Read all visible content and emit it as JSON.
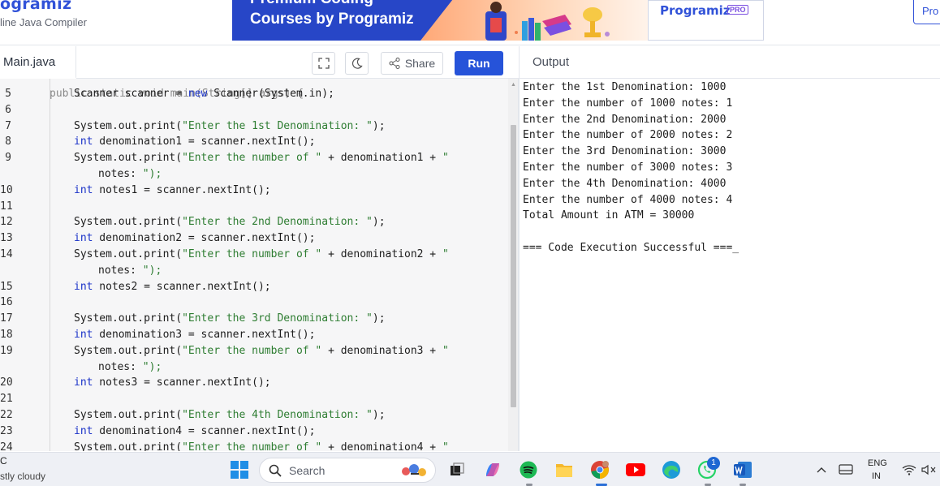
{
  "header": {
    "brand": "ogramiz",
    "subtitle": "line Java Compiler",
    "banner_top": "Premium Coding",
    "banner_text": "Courses by Programiz",
    "banner_logo": "Programiz",
    "banner_pro": "PRO",
    "pro_button": "Pro"
  },
  "toolbar": {
    "file_tab": "Main.java",
    "fullscreen_icon": "fullscreen-icon",
    "theme_icon": "moon-icon",
    "share_label": "Share",
    "run_label": "Run",
    "output_title": "Output"
  },
  "editor": {
    "partial_top": "public static void main(String[] args) {",
    "lines": [
      {
        "num": "5",
        "text": "Scanner scanner = new Scanner(System.in);"
      },
      {
        "num": "6",
        "text": ""
      },
      {
        "num": "7",
        "text": "System.out.print(\"Enter the 1st Denomination: \");"
      },
      {
        "num": "8",
        "text": "int denomination1 = scanner.nextInt();"
      },
      {
        "num": "9",
        "text": "System.out.print(\"Enter the number of \" + denomination1 + \""
      },
      {
        "num": "",
        "text": "notes: \");"
      },
      {
        "num": "10",
        "text": "int notes1 = scanner.nextInt();"
      },
      {
        "num": "11",
        "text": ""
      },
      {
        "num": "12",
        "text": "System.out.print(\"Enter the 2nd Denomination: \");"
      },
      {
        "num": "13",
        "text": "int denomination2 = scanner.nextInt();"
      },
      {
        "num": "14",
        "text": "System.out.print(\"Enter the number of \" + denomination2 + \""
      },
      {
        "num": "",
        "text": "notes: \");"
      },
      {
        "num": "15",
        "text": "int notes2 = scanner.nextInt();"
      },
      {
        "num": "16",
        "text": ""
      },
      {
        "num": "17",
        "text": "System.out.print(\"Enter the 3rd Denomination: \");"
      },
      {
        "num": "18",
        "text": "int denomination3 = scanner.nextInt();"
      },
      {
        "num": "19",
        "text": "System.out.print(\"Enter the number of \" + denomination3 + \""
      },
      {
        "num": "",
        "text": "notes: \");"
      },
      {
        "num": "20",
        "text": "int notes3 = scanner.nextInt();"
      },
      {
        "num": "21",
        "text": ""
      },
      {
        "num": "22",
        "text": "System.out.print(\"Enter the 4th Denomination: \");"
      },
      {
        "num": "23",
        "text": "int denomination4 = scanner.nextInt();"
      },
      {
        "num": "24",
        "text": "System.out.print(\"Enter the number of \" + denomination4 + \""
      }
    ]
  },
  "output": {
    "lines": [
      "Enter the 1st Denomination: 1000",
      "Enter the number of 1000 notes: 1",
      "Enter the 2nd Denomination: 2000",
      "Enter the number of 2000 notes: 2",
      "Enter the 3rd Denomination: 3000",
      "Enter the number of 3000 notes: 3",
      "Enter the 4th Denomination: 4000",
      "Enter the number of 4000 notes: 4",
      "Total Amount in ATM = 30000",
      "",
      "=== Code Execution Successful ===_"
    ]
  },
  "taskbar": {
    "weather_temp": "C",
    "weather_desc": "stly cloudy",
    "search_label": "Search",
    "lang_line1": "ENG",
    "lang_line2": "IN",
    "whatsapp_badge": "1"
  },
  "colors": {
    "run_button": "#2653d9",
    "banner": "#2746c7",
    "keyword": "#1b33c8",
    "string": "#2e7d32"
  }
}
